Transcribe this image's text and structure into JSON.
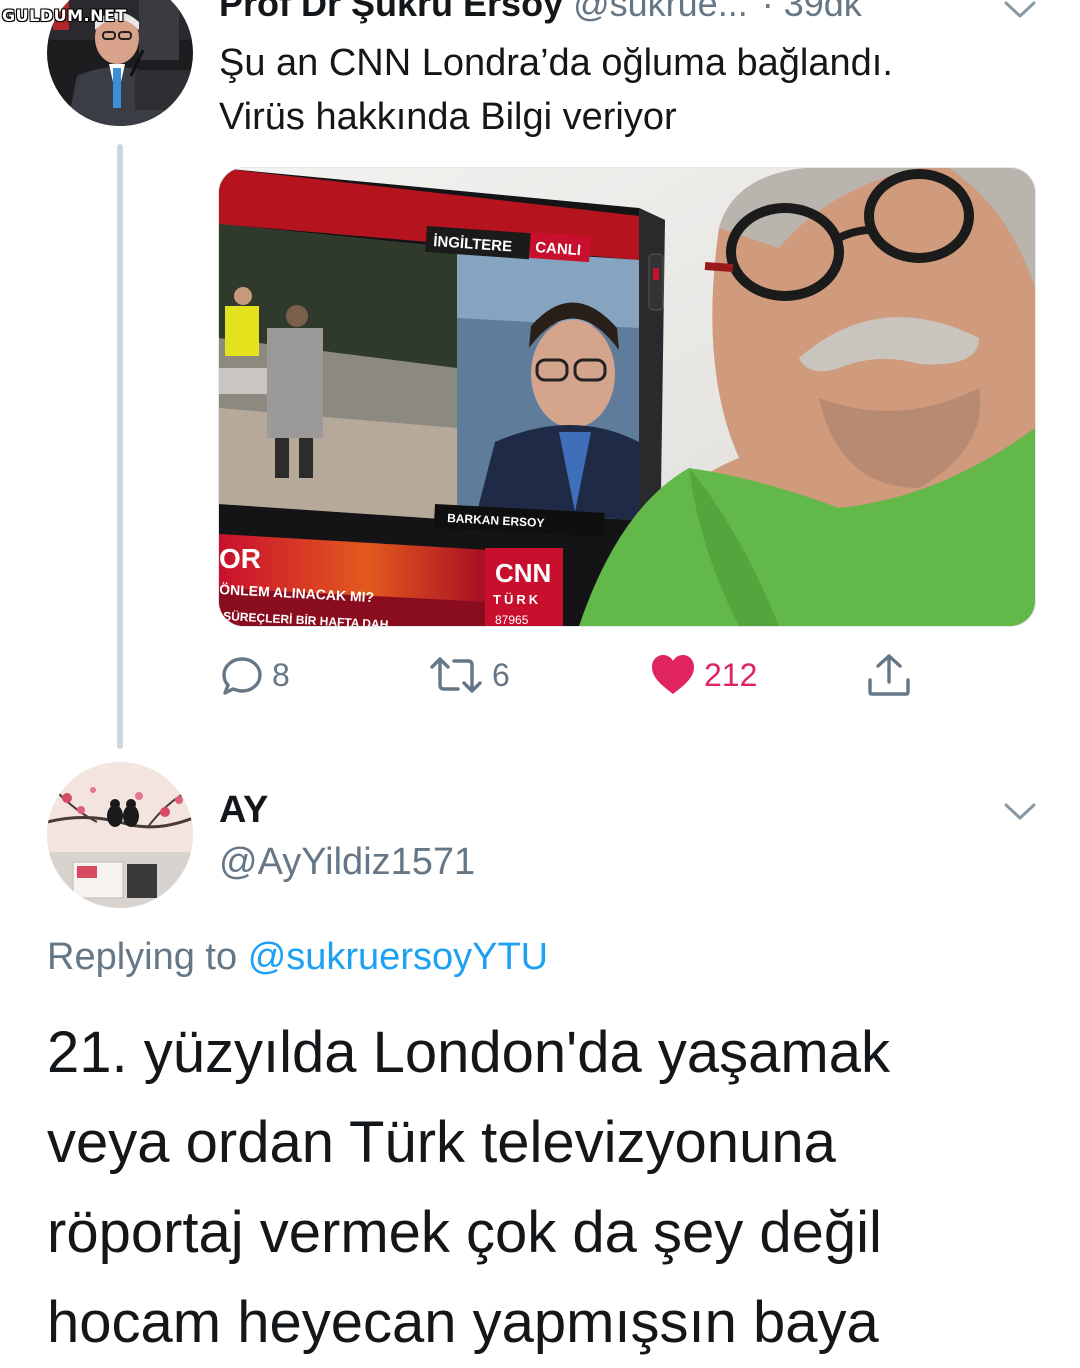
{
  "watermark": "GULDUM.NET",
  "tweet1": {
    "author_name": "Prof Dr Şükrü Ersoy",
    "author_handle": "@sukrue...",
    "time": "· 39dk",
    "text_lines": [
      "Şu an CNN Londra’da oğluma bağlandı.",
      "Virüs hakkında Bilgi veriyor"
    ],
    "media": {
      "tv_tag_country": "İNGİLTERE",
      "tv_tag_live": "CANLI",
      "lower_third_name": "BARKAN ERSOY",
      "ticker_big": "OR",
      "ticker_line1": "ÖNLEM ALINACAK MI?",
      "ticker_line2": "SÜREÇLERİ BİR HAFTA DAH",
      "channel_logo": "CNN",
      "channel_sub": "TÜRK",
      "ticker_number": "87965"
    },
    "actions": {
      "replies": "8",
      "retweets": "6",
      "likes": "212"
    }
  },
  "tweet2": {
    "author_name": "AY",
    "author_handle": "@AyYildiz1571",
    "replying_prefix": "Replying to",
    "replying_to": "@sukruersoyYTU",
    "text_lines": [
      "21. yüzyılda London'da yaşamak",
      "veya ordan Türk televizyonuna",
      "röportaj vermek çok da şey değil",
      "hocam heyecan yapmışsın baya"
    ]
  },
  "colors": {
    "text_primary": "#14171a",
    "text_secondary": "#657786",
    "link": "#1da1f2",
    "like": "#e0245e",
    "thread_line": "#cdd6dd"
  }
}
